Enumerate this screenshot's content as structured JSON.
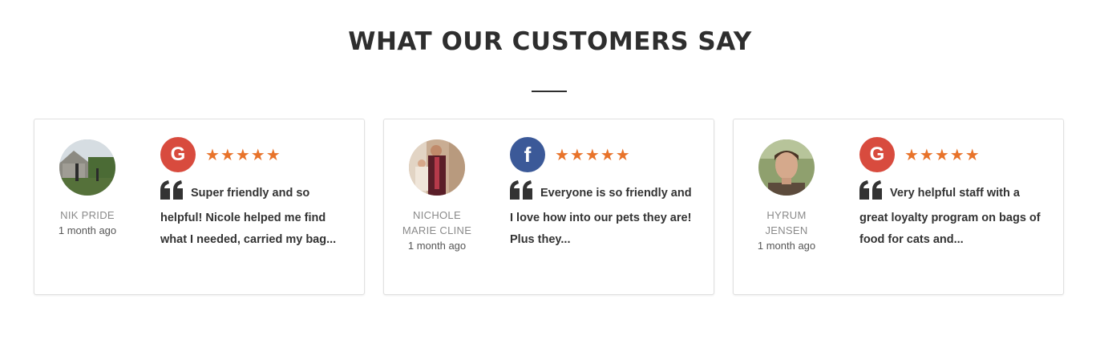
{
  "section": {
    "title": "WHAT OUR CUSTOMERS SAY"
  },
  "reviews": [
    {
      "author_name": "NIK PRIDE",
      "time": "1 month ago",
      "source": "google",
      "source_label": "G",
      "rating": 5,
      "stars": "★★★★★",
      "text": "Super friendly and so helpful! Nicole helped me find what I needed, carried my bag..."
    },
    {
      "author_name": "NICHOLE MARIE CLINE",
      "time": "1 month ago",
      "source": "facebook",
      "source_label": "f",
      "rating": 5,
      "stars": "★★★★★",
      "text": "Everyone is so friendly and I love how into our pets they are! Plus they..."
    },
    {
      "author_name": "HYRUM JENSEN",
      "time": "1 month ago",
      "source": "google",
      "source_label": "G",
      "rating": 5,
      "stars": "★★★★★",
      "text": "Very helpful staff with a great loyalty program on bags of food for cats and..."
    }
  ],
  "colors": {
    "star": "#e8732a",
    "google": "#d84b3e",
    "facebook": "#3b5998"
  }
}
